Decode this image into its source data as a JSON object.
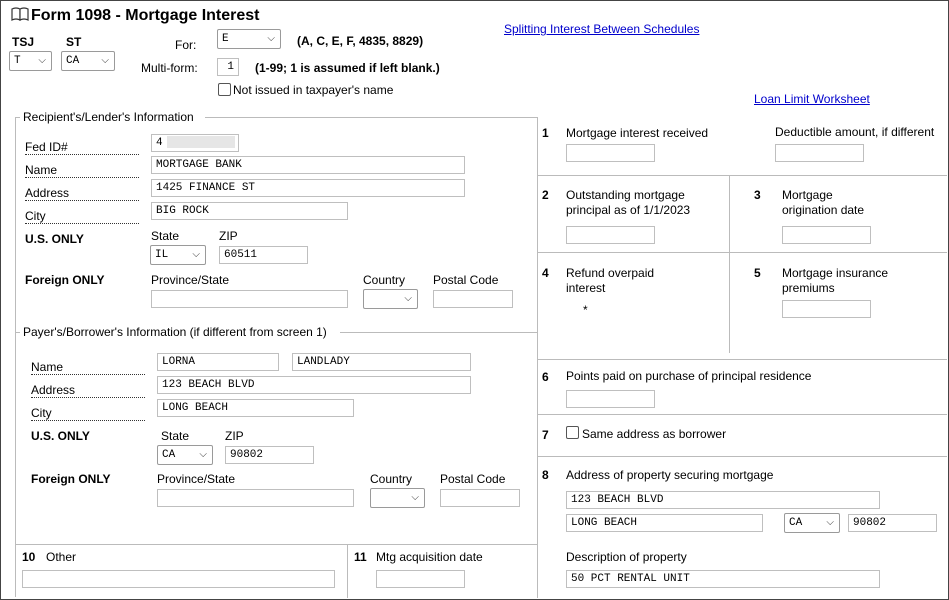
{
  "header": {
    "title": "Form 1098 - Mortgage Interest",
    "tsj_label": "TSJ",
    "tsj_value": "T",
    "st_label": "ST",
    "st_value": "CA",
    "for_label": "For:",
    "for_value": "E",
    "for_hint": "(A, C, E, F, 4835, 8829)",
    "multiform_label": "Multi-form:",
    "multiform_value": "1",
    "multiform_hint": "(1-99; 1 is assumed if left blank.)",
    "not_issued_label": "Not issued in taxpayer's name",
    "link_splitting": "Splitting Interest Between Schedules",
    "link_loan_limit": "Loan Limit Worksheet"
  },
  "recipient": {
    "section_title": "Recipient's/Lender's Information",
    "fedid_label": "Fed ID#",
    "fedid_value": "4",
    "name_label": "Name",
    "name_value": "MORTGAGE BANK",
    "address_label": "Address",
    "address_value": "1425 FINANCE ST",
    "city_label": "City",
    "city_value": "BIG ROCK",
    "us_only": "U.S. ONLY",
    "state_label": "State",
    "state_value": "IL",
    "zip_label": "ZIP",
    "zip_value": "60511",
    "foreign_only": "Foreign ONLY",
    "province_label": "Province/State",
    "country_label": "Country",
    "postal_label": "Postal Code"
  },
  "payer": {
    "section_title": "Payer's/Borrower's Information (if different from screen 1)",
    "name_label": "Name",
    "first_name": "LORNA",
    "last_name": "LANDLADY",
    "address_label": "Address",
    "address_value": "123 BEACH BLVD",
    "city_label": "City",
    "city_value": "LONG BEACH",
    "us_only": "U.S. ONLY",
    "state_label": "State",
    "state_value": "CA",
    "zip_label": "ZIP",
    "zip_value": "90802",
    "foreign_only": "Foreign ONLY",
    "province_label": "Province/State",
    "country_label": "Country",
    "postal_label": "Postal Code"
  },
  "bottom": {
    "box10_num": "10",
    "box10_label": "Other",
    "box11_num": "11",
    "box11_label": "Mtg acquisition date"
  },
  "boxes": {
    "b1_num": "1",
    "b1_label": "Mortgage interest received",
    "b1_deductible": "Deductible amount, if different",
    "b2_num": "2",
    "b2_label_1": "Outstanding mortgage",
    "b2_label_2": "principal as of 1/1/2023",
    "b3_num": "3",
    "b3_label_1": "Mortgage",
    "b3_label_2": "origination date",
    "b4_num": "4",
    "b4_label_1": "Refund overpaid",
    "b4_label_2": "interest",
    "b4_star": "*",
    "b5_num": "5",
    "b5_label_1": "Mortgage insurance",
    "b5_label_2": "premiums",
    "b6_num": "6",
    "b6_label": "Points paid on purchase of principal residence",
    "b7_num": "7",
    "b7_label": "Same address as borrower",
    "b8_num": "8",
    "b8_label": "Address of property securing mortgage",
    "b8_address": "123 BEACH BLVD",
    "b8_city": "LONG BEACH",
    "b8_state": "CA",
    "b8_zip": "90802",
    "b8_desc_label": "Description of property",
    "b8_desc_value": "50 PCT RENTAL UNIT"
  }
}
